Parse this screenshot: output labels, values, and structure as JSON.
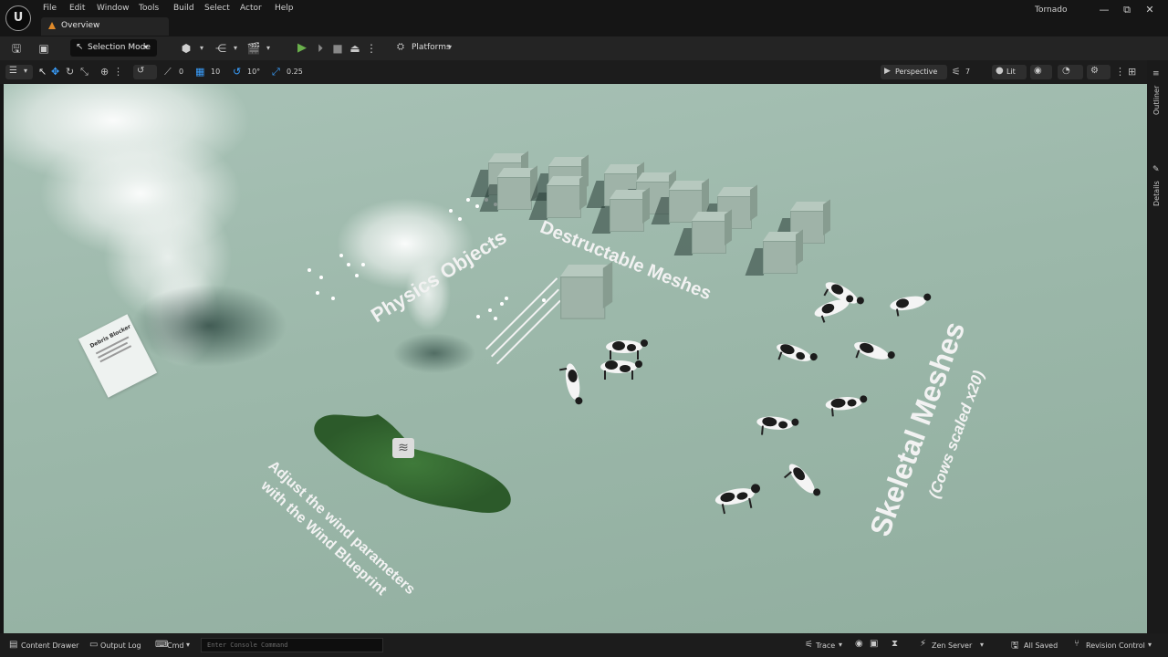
{
  "menu": [
    "File",
    "Edit",
    "Window",
    "Tools",
    "Build",
    "Select",
    "Actor",
    "Help"
  ],
  "tab": {
    "label": "Overview"
  },
  "app_title": "Tornado",
  "window_controls": {
    "minimize": "—",
    "maximize": "⧉",
    "close": "✕"
  },
  "toolbar": {
    "selection_mode": "Selection Mode",
    "platforms": "Platforms"
  },
  "viewport_toolbar": {
    "rotation_snap": "0",
    "grid_snap": "10",
    "angle_snap": "10°",
    "scale_snap": "0.25",
    "view_mode": "Perspective",
    "camera_speed": "7",
    "lighting": "Lit"
  },
  "sidebar": {
    "outliner": "Outliner",
    "details": "Details"
  },
  "scene": {
    "physics_label": "Physics Objects",
    "destructable_label": "Destructable Meshes",
    "skeletal_label": "Skeletal Meshes",
    "cows_note": "(Cows scaled x20)",
    "wind_line1": "Adjust the wind parameters",
    "wind_line2": "with the Wind Blueprint",
    "debris_title": "Debris Blocker"
  },
  "bottombar": {
    "content_drawer": "Content Drawer",
    "output_log": "Output Log",
    "cmd": "Cmd",
    "console_placeholder": "Enter Console Command",
    "trace": "Trace",
    "zen_server": "Zen Server",
    "all_saved": "All Saved",
    "revision_control": "Revision Control"
  },
  "colors": {
    "accent_blue": "#3aa0ff",
    "play_green": "#6ab04c",
    "warn_orange": "#e08a2a",
    "viewport_bg": "#9cb8aa"
  }
}
